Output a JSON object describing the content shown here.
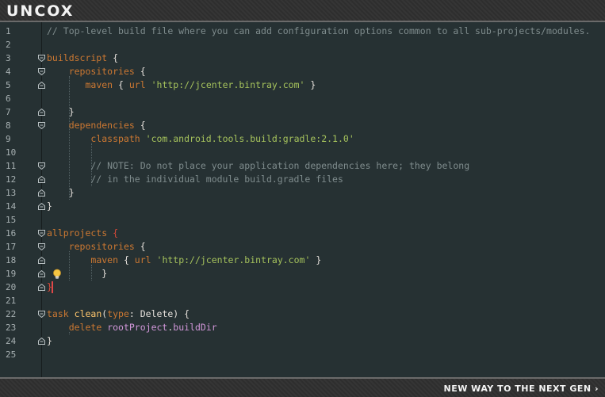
{
  "brand": {
    "logo_text": "UNCOX",
    "tagline": "NEW WAY TO THE NEXT GEN",
    "tagline_arrow": "›"
  },
  "colors": {
    "background": "#263133",
    "keyword": "#cc7832",
    "string": "#a5c25c",
    "comment": "#7f8c8d",
    "function": "#ffc66d",
    "property": "#d197d9",
    "caret": "#e04848"
  },
  "editor": {
    "line_numbers": [
      "1",
      "2",
      "3",
      "4",
      "5",
      "6",
      "7",
      "8",
      "9",
      "10",
      "11",
      "12",
      "13",
      "14",
      "15",
      "16",
      "17",
      "18",
      "19",
      "20",
      "21",
      "22",
      "23",
      "24",
      "25"
    ],
    "lines": [
      {
        "tokens": [
          {
            "t": "// Top-level build file where you can add configuration options common to all sub-projects/modules.",
            "c": "cm"
          }
        ]
      },
      {
        "tokens": []
      },
      {
        "tokens": [
          {
            "t": "buildscript",
            "c": "kw"
          },
          {
            "t": " {",
            "c": "pu"
          }
        ]
      },
      {
        "tokens": [
          {
            "t": "    ",
            "c": "pu"
          },
          {
            "t": "repositories",
            "c": "kw"
          },
          {
            "t": " {",
            "c": "pu"
          }
        ]
      },
      {
        "tokens": [
          {
            "t": "       ",
            "c": "pu"
          },
          {
            "t": "maven",
            "c": "kw"
          },
          {
            "t": " { ",
            "c": "pu"
          },
          {
            "t": "url",
            "c": "kw"
          },
          {
            "t": " ",
            "c": "pu"
          },
          {
            "t": "'http://jcenter.bintray.com'",
            "c": "str"
          },
          {
            "t": " }",
            "c": "pu"
          }
        ]
      },
      {
        "tokens": []
      },
      {
        "tokens": [
          {
            "t": "    }",
            "c": "pu"
          }
        ]
      },
      {
        "tokens": [
          {
            "t": "    ",
            "c": "pu"
          },
          {
            "t": "dependencies",
            "c": "kw"
          },
          {
            "t": " {",
            "c": "pu"
          }
        ]
      },
      {
        "tokens": [
          {
            "t": "        ",
            "c": "pu"
          },
          {
            "t": "classpath",
            "c": "kw"
          },
          {
            "t": " ",
            "c": "pu"
          },
          {
            "t": "'com.android.tools.build:gradle:2.1.0'",
            "c": "str"
          }
        ]
      },
      {
        "tokens": []
      },
      {
        "tokens": [
          {
            "t": "        // NOTE: Do not place your application dependencies here; they belong",
            "c": "cm"
          }
        ]
      },
      {
        "tokens": [
          {
            "t": "        // in the individual module build.gradle files",
            "c": "cm"
          }
        ]
      },
      {
        "tokens": [
          {
            "t": "    }",
            "c": "pu"
          }
        ]
      },
      {
        "tokens": [
          {
            "t": "}",
            "c": "pu"
          }
        ]
      },
      {
        "tokens": []
      },
      {
        "tokens": [
          {
            "t": "allprojects",
            "c": "kw"
          },
          {
            "t": " {",
            "c": "pr"
          }
        ]
      },
      {
        "tokens": [
          {
            "t": "    ",
            "c": "pu"
          },
          {
            "t": "repositories",
            "c": "kw"
          },
          {
            "t": " {",
            "c": "pu"
          }
        ]
      },
      {
        "tokens": [
          {
            "t": "        ",
            "c": "pu"
          },
          {
            "t": "maven",
            "c": "kw"
          },
          {
            "t": " { ",
            "c": "pu"
          },
          {
            "t": "url",
            "c": "kw"
          },
          {
            "t": " ",
            "c": "pu"
          },
          {
            "t": "'http://jcenter.bintray.com'",
            "c": "str"
          },
          {
            "t": " }",
            "c": "pu"
          }
        ]
      },
      {
        "tokens": [
          {
            "t": "          }",
            "c": "pu"
          }
        ]
      },
      {
        "tokens": [
          {
            "t": "}",
            "c": "pr"
          }
        ]
      },
      {
        "tokens": []
      },
      {
        "tokens": [
          {
            "t": "task",
            "c": "kw"
          },
          {
            "t": " ",
            "c": "pu"
          },
          {
            "t": "clean",
            "c": "fn"
          },
          {
            "t": "(",
            "c": "pu"
          },
          {
            "t": "type",
            "c": "kw"
          },
          {
            "t": ": Delete) {",
            "c": "pu"
          }
        ]
      },
      {
        "tokens": [
          {
            "t": "    ",
            "c": "pu"
          },
          {
            "t": "delete",
            "c": "kw"
          },
          {
            "t": " ",
            "c": "pu"
          },
          {
            "t": "rootProject",
            "c": "field"
          },
          {
            "t": ".",
            "c": "pu"
          },
          {
            "t": "buildDir",
            "c": "field"
          }
        ]
      },
      {
        "tokens": [
          {
            "t": "}",
            "c": "pu"
          }
        ]
      },
      {
        "tokens": []
      }
    ],
    "fold_markers": {
      "3": "open",
      "4": "open",
      "5": "close",
      "7": "close",
      "8": "open",
      "11": "open",
      "12": "close",
      "13": "close",
      "14": "close",
      "16": "open",
      "17": "open",
      "18": "close",
      "19": "close",
      "20": "close",
      "22": "open",
      "24": "close"
    },
    "lightbulb_line": 19,
    "caret_line": 20
  }
}
